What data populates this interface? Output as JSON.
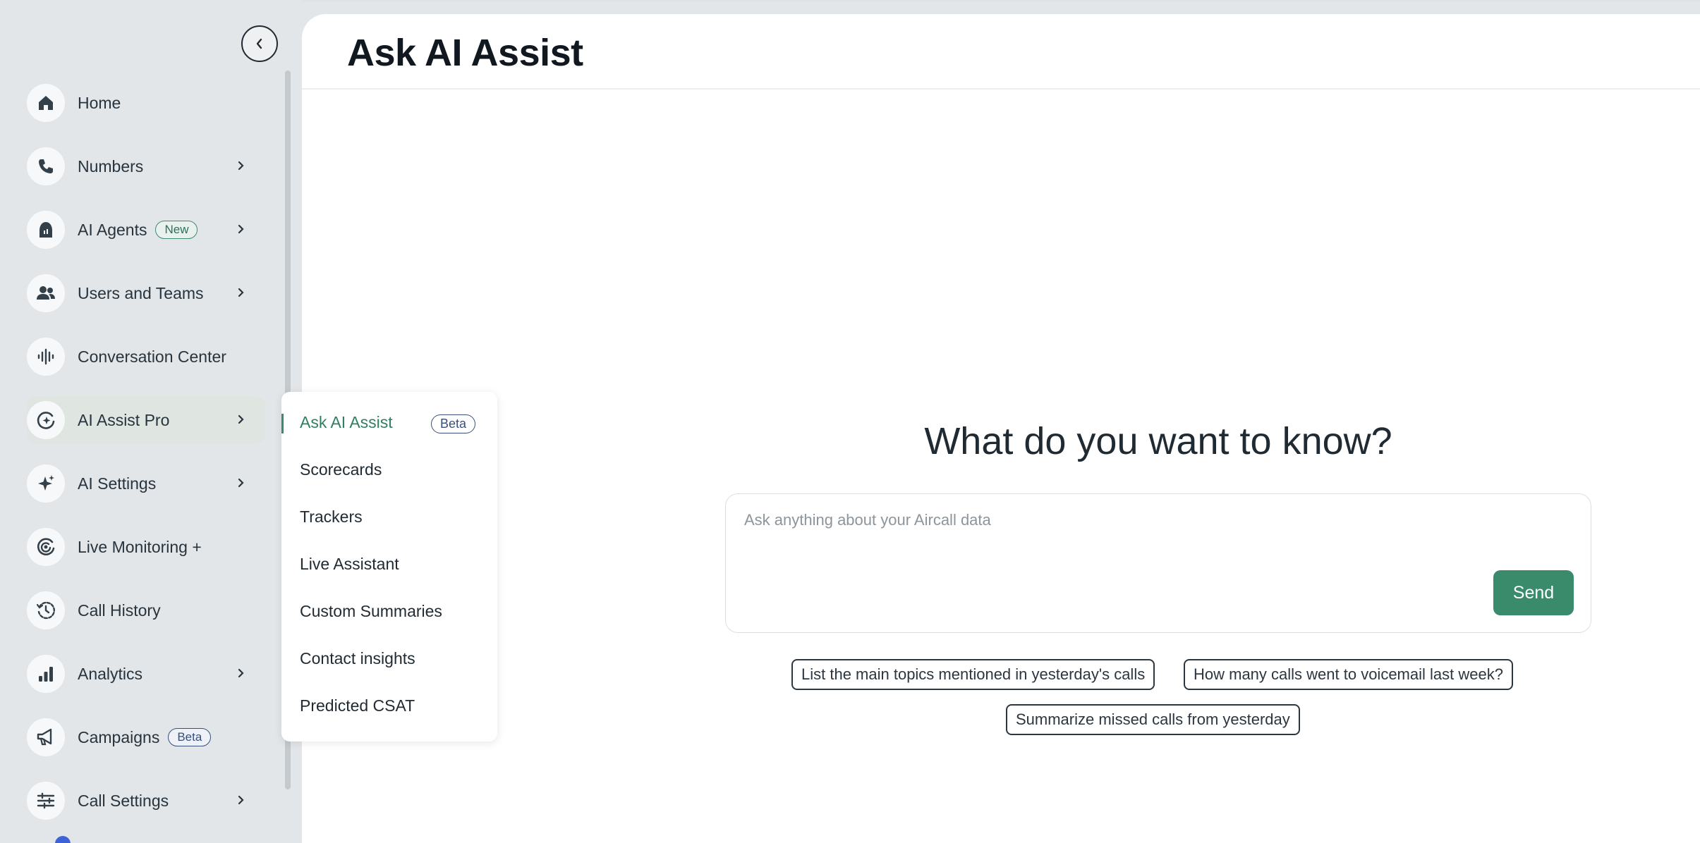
{
  "sidebar": {
    "items": [
      {
        "label": "Home",
        "icon": "home-icon",
        "has_chevron": false
      },
      {
        "label": "Numbers",
        "icon": "phone-icon",
        "has_chevron": true
      },
      {
        "label": "AI Agents",
        "icon": "ai-agent-icon",
        "badge": "New",
        "has_chevron": true
      },
      {
        "label": "Users and Teams",
        "icon": "users-icon",
        "has_chevron": true
      },
      {
        "label": "Conversation Center",
        "icon": "waveform-icon",
        "has_chevron": false
      },
      {
        "label": "AI Assist Pro",
        "icon": "ai-assist-icon",
        "has_chevron": true,
        "active": true
      },
      {
        "label": "AI Settings",
        "icon": "sparkle-icon",
        "has_chevron": true
      },
      {
        "label": "Live Monitoring +",
        "icon": "live-monitoring-icon",
        "has_chevron": false
      },
      {
        "label": "Call History",
        "icon": "history-icon",
        "has_chevron": false
      },
      {
        "label": "Analytics",
        "icon": "bar-chart-icon",
        "has_chevron": true
      },
      {
        "label": "Campaigns",
        "icon": "megaphone-icon",
        "badge": "Beta",
        "has_chevron": true
      },
      {
        "label": "Call Settings",
        "icon": "sliders-icon",
        "has_chevron": true
      }
    ]
  },
  "flyout": {
    "items": [
      {
        "label": "Ask AI Assist",
        "badge": "Beta",
        "active": true
      },
      {
        "label": "Scorecards"
      },
      {
        "label": "Trackers"
      },
      {
        "label": "Live Assistant"
      },
      {
        "label": "Custom Summaries"
      },
      {
        "label": "Contact insights"
      },
      {
        "label": "Predicted CSAT"
      }
    ]
  },
  "main": {
    "title": "Ask AI Assist",
    "hero": "What do you want to know?",
    "input_placeholder": "Ask anything about your Aircall data",
    "input_value": "",
    "send_label": "Send",
    "suggestions": [
      "List the main topics mentioned in yesterday's calls",
      "How many calls went to voicemail last week?",
      "Summarize missed calls from yesterday"
    ]
  },
  "colors": {
    "accent": "#3a8a6c",
    "sidebar_bg": "#e3e6e9",
    "badge_blue": "#38507a"
  }
}
